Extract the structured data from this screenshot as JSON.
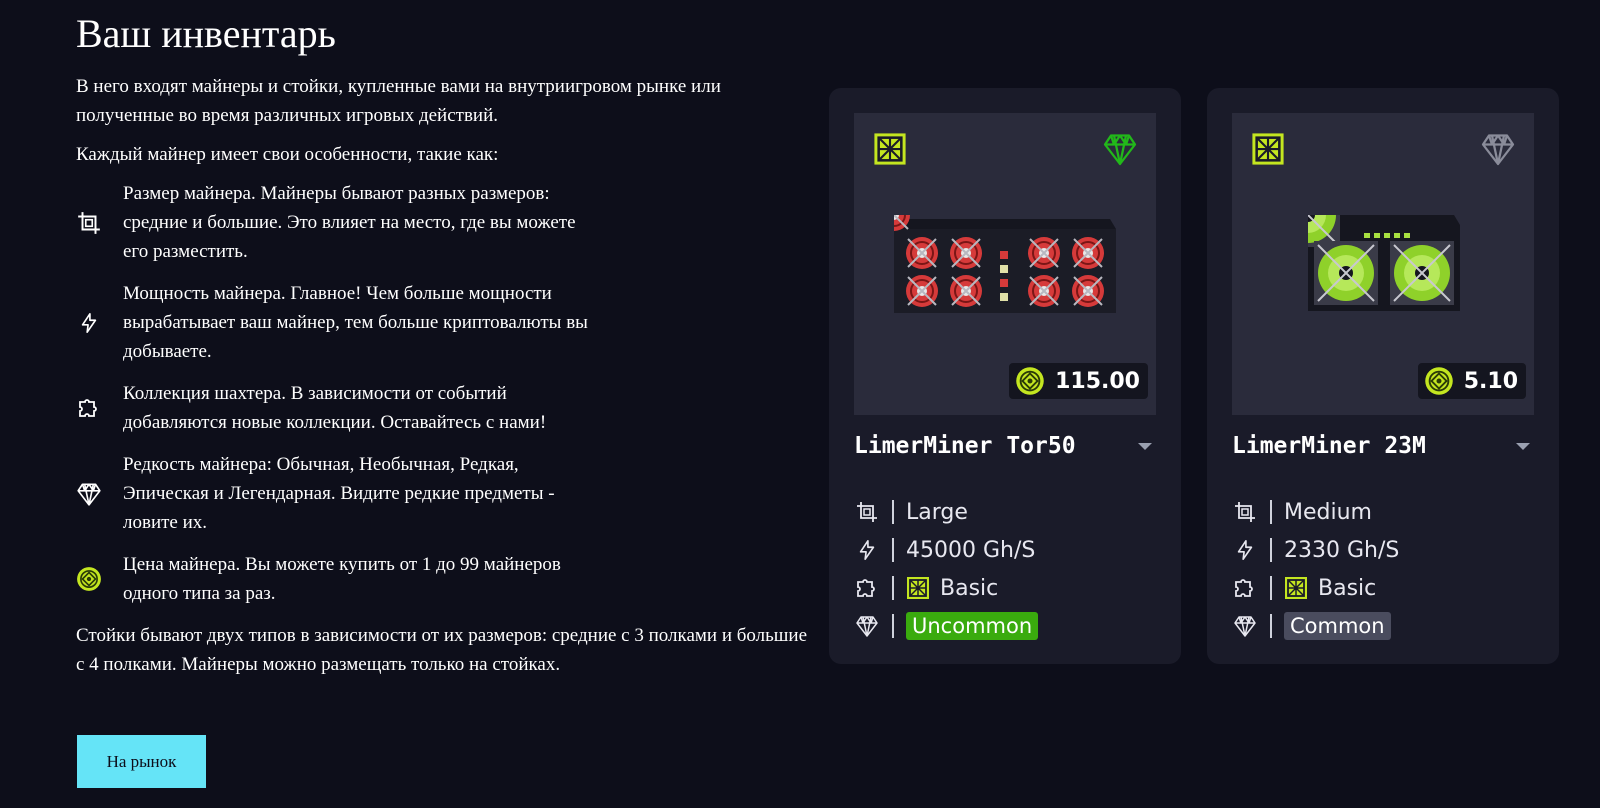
{
  "title": "Ваш инвентарь",
  "intro": "В него входят майнеры и стойки, купленные вами на внутриигровом рынке или полученные во время различных игровых действий.",
  "features_intro": "Каждый майнер имеет свои особенности, такие как:",
  "features": [
    {
      "icon": "size-icon",
      "text": "Размер майнера. Майнеры бывают разных размеров: средние и большие. Это влияет на место, где вы можете его разместить."
    },
    {
      "icon": "power-icon",
      "text": "Мощность майнера. Главное! Чем больше мощности вырабатывает ваш майнер, тем больше криптовалюты вы добываете."
    },
    {
      "icon": "puzzle-icon",
      "text": "Коллекция шахтера. В зависимости от событий добавляются новые коллекции. Оставайтесь с нами!"
    },
    {
      "icon": "diamond-icon",
      "text": "Редкость майнера: Обычная, Необычная, Редкая, Эпическая и Легендарная. Видите редкие предметы - ловите их."
    },
    {
      "icon": "coin-icon",
      "text": "Цена майнера. Вы можете купить от 1 до 99 майнеров одного типа за раз."
    }
  ],
  "racks_text": "Стойки бывают двух типов в зависимости от их размеров: средние с 3 полками и большие с 4 полками. Майнеры можно размещать только на стойках.",
  "market_button": "На рынок",
  "cards": [
    {
      "name": "LimerMiner Tor50",
      "price": "115.00",
      "size": "Large",
      "power": "45000 Gh/S",
      "collection": "Basic",
      "rarity": "Uncommon",
      "rarity_color": "#3aab0e",
      "gem_color": "#22b81a"
    },
    {
      "name": "LimerMiner 23M",
      "price": "5.10",
      "size": "Medium",
      "power": "2330 Gh/S",
      "collection": "Basic",
      "rarity": "Common",
      "rarity_color": "#4a4c5e",
      "gem_color": "#8a8c9a"
    }
  ],
  "colors": {
    "background": "#0d0e1a",
    "card": "#1a1b29",
    "accent": "#c4e620",
    "button": "#65e4f7"
  }
}
